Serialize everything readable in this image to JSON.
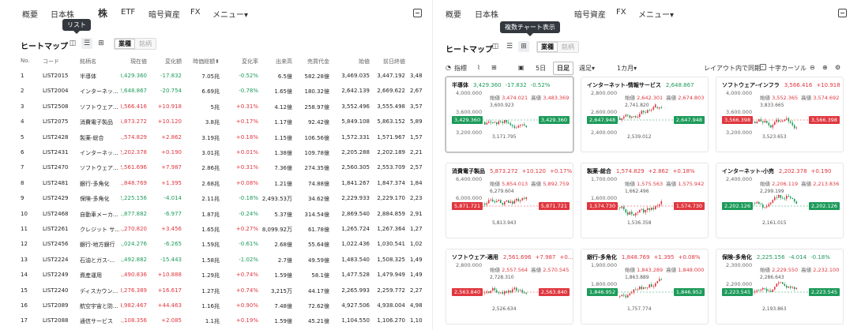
{
  "nav": {
    "items": [
      "概要",
      "日本株",
      "ETF",
      "暗号資産",
      "FX",
      "メニュー▾"
    ],
    "left_active": "株"
  },
  "toolbar": {
    "title": "ヒートマップ",
    "seg_active": "業種",
    "seg_other": "銘柄"
  },
  "tooltips": {
    "list": "リスト",
    "chart": "複数チャート表示"
  },
  "table": {
    "headers": [
      "No.",
      "コード",
      "銘柄名",
      "現在値",
      "変化額",
      "時価総額⬍",
      "変化率",
      "出来高",
      "売買代金",
      "始値",
      "前日終値"
    ],
    "rows": [
      [
        "1",
        "LIST2015",
        "半導体",
        "3,429.360",
        "-17.832",
        "7.05兆",
        "-0.52%",
        "6.5億",
        "582.28億",
        "3,469.035",
        "3,447.192",
        "3,48"
      ],
      [
        "2",
        "LIST2004",
        "インターネッ...",
        "2,648.867",
        "-20.754",
        "6.69兆",
        "-0.78%",
        "1.65億",
        "180.32億",
        "2,642.139",
        "2,669.622",
        "2,67"
      ],
      [
        "3",
        "LIST2508",
        "ソフトウェア...",
        "3,566.416",
        "+10.918",
        "5兆",
        "+0.31%",
        "4.12億",
        "258.97億",
        "3,552.496",
        "3,555.498",
        "3,57"
      ],
      [
        "4",
        "LIST2075",
        "消費電子製品",
        "5,873.272",
        "+10.120",
        "3.8兆",
        "+0.17%",
        "1.17億",
        "92.42億",
        "5,849.108",
        "5,863.152",
        "5,89"
      ],
      [
        "5",
        "LIST2428",
        "製薬-総合",
        "1,574.829",
        "+2.862",
        "3.19兆",
        "+0.18%",
        "1.15億",
        "106.56億",
        "1,572.331",
        "1,571.967",
        "1,57"
      ],
      [
        "6",
        "LIST2431",
        "インターネッ...",
        "2,202.378",
        "+0.190",
        "3.01兆",
        "+0.01%",
        "1.38億",
        "109.78億",
        "2,205.288",
        "2,202.189",
        "2,21"
      ],
      [
        "7",
        "LIST2470",
        "ソフトウェア...",
        "2,561.696",
        "+7.987",
        "2.86兆",
        "+0.31%",
        "7.36億",
        "274.35億",
        "2,560.305",
        "2,553.709",
        "2,57"
      ],
      [
        "8",
        "LIST2481",
        "銀行-多角化",
        "1,848.769",
        "+1.395",
        "2.68兆",
        "+0.08%",
        "1.21億",
        "74.88億",
        "1,841.267",
        "1,847.374",
        "1,84"
      ],
      [
        "9",
        "LIST2429",
        "保険-多角化",
        "2,225.156",
        "-4.014",
        "2.11兆",
        "-0.18%",
        "2,493.53万",
        "34.62億",
        "2,229.933",
        "2,229.170",
        "2,23"
      ],
      [
        "10",
        "LIST2468",
        "自動車メーカ...",
        "1,877.882",
        "-6.977",
        "1.87兆",
        "-0.24%",
        "5.37億",
        "314.54億",
        "2,869.540",
        "2,884.859",
        "2,91"
      ],
      [
        "11",
        "LIST2261",
        "クレジット サ...",
        "1,270.820",
        "+3.456",
        "1.65兆",
        "+0.27%",
        "8,099.92万",
        "61.78億",
        "1,265.724",
        "1,267.364",
        "1,27"
      ],
      [
        "12",
        "LIST2456",
        "銀行-地方銀行",
        "1,024.276",
        "-6.265",
        "1.59兆",
        "-0.61%",
        "2.68億",
        "55.64億",
        "1,022.436",
        "1,030.541",
        "1,02"
      ],
      [
        "13",
        "LIST2224",
        "石油とガス-...",
        "1,492.882",
        "-15.443",
        "1.58兆",
        "-1.02%",
        "2.7億",
        "49.59億",
        "1,483.540",
        "1,508.325",
        "1,49"
      ],
      [
        "14",
        "LIST2249",
        "資産運用",
        "1,490.836",
        "+10.888",
        "1.29兆",
        "+0.74%",
        "1.59億",
        "58.1億",
        "1,477.528",
        "1,479.949",
        "1,49"
      ],
      [
        "15",
        "LIST2240",
        "ディスカウン...",
        "3,276.389",
        "+16.617",
        "1.27兆",
        "+0.74%",
        "3,215万",
        "44.17億",
        "2,265.993",
        "2,259.772",
        "2,27"
      ],
      [
        "16",
        "LIST2089",
        "航空宇宙と防...",
        "4,982.467",
        "+44.463",
        "1.16兆",
        "+0.90%",
        "7.48億",
        "72.62億",
        "4,927.506",
        "4,938.004",
        "4,98"
      ],
      [
        "17",
        "LIST2088",
        "通信サービス",
        "1,108.356",
        "+2.085",
        "1.1兆",
        "+0.19%",
        "1.59億",
        "45.21億",
        "1,104.550",
        "1,106.270",
        "1,10"
      ]
    ]
  },
  "controls": {
    "indicator": "指標",
    "d5": "5日",
    "daily": "日足",
    "weekly": "週足▾",
    "month": "1カ月▾",
    "sync": "レイアウト内で同期：",
    "crosshair": "十字カーソル"
  },
  "cards": [
    {
      "title": "半導体",
      "price": "3,429.360",
      "chg": "-17.832",
      "pct": "-0.52%",
      "dir": "dn",
      "y1": "4,000.000",
      "y2": "3,600.000",
      "y3": "3,200.000",
      "open": "3,474.021",
      "high": "3,483.369",
      "hiv": "3,600.923",
      "lov": "3,171.795",
      "tagL": "3,429.360",
      "tagR": "3,429.360",
      "t": "g"
    },
    {
      "title": "インターネット-情報サービス",
      "price": "2,648.867",
      "chg": "",
      "pct": "",
      "dir": "dn",
      "y1": "2,800.000",
      "y2": "2,600.000",
      "y3": "2,400.000",
      "open": "2,642.301",
      "high": "2,674.803",
      "hiv": "2,741.820",
      "lov": "2,539.012",
      "tagL": "2,647.948",
      "tagR": "2,647.948",
      "t": "g"
    },
    {
      "title": "ソフトウェア-インフラ",
      "price": "3,566.416",
      "chg": "+10.918",
      "pct": "",
      "dir": "up",
      "y1": "4,000.000",
      "y2": "3,600.000",
      "y3": "3,200.000",
      "open": "3,552.365",
      "high": "3,574.692",
      "hiv": "3,833.665",
      "lov": "3,523.653",
      "tagL": "3,566.398",
      "tagR": "3,566.398",
      "t": "r"
    },
    {
      "title": "消費電子製品",
      "price": "5,873.272",
      "chg": "+10.120",
      "pct": "+0.17%",
      "dir": "up",
      "y1": "6,400.000",
      "y2": "6,000.000",
      "y3": "",
      "open": "5,854.013",
      "high": "5,892.759",
      "hiv": "6,279.604",
      "lov": "5,813.943",
      "tagL": "5,871.721",
      "tagR": "5,871.721",
      "t": "r"
    },
    {
      "title": "製薬-総合",
      "price": "1,574.829",
      "chg": "+2.862",
      "pct": "+0.18%",
      "dir": "up",
      "y1": "1,700.000",
      "y2": "1,600.000",
      "y3": "",
      "open": "1,575.563",
      "high": "1,575.942",
      "hiv": "1,662.496",
      "lov": "1,536.358",
      "tagL": "1,574.730",
      "tagR": "1,574.730",
      "t": "r"
    },
    {
      "title": "インターネット-小売",
      "price": "2,202.378",
      "chg": "+0.190",
      "pct": "",
      "dir": "up",
      "y1": "2,400.000",
      "y2": "",
      "y3": "",
      "open": "2,206.119",
      "high": "2,213.836",
      "hiv": "2,299.199",
      "lov": "2,161.015",
      "tagL": "2,202.126",
      "tagR": "2,202.126",
      "t": "g"
    },
    {
      "title": "ソフトウェア-適用",
      "price": "2,561.696",
      "chg": "+7.987",
      "pct": "+0...",
      "dir": "up",
      "y1": "2,800.000",
      "y2": "",
      "y3": "",
      "open": "2,557.564",
      "high": "2,570.545",
      "hiv": "2,728.310",
      "lov": "2,526.634",
      "tagL": "2,563.840",
      "tagR": "2,563.840",
      "t": "r"
    },
    {
      "title": "銀行-多角化",
      "price": "1,848.769",
      "chg": "+1.395",
      "pct": "+0.08%",
      "dir": "up",
      "y1": "1,900.000",
      "y2": "1,800.000",
      "y3": "",
      "open": "1,843.289",
      "high": "1,848.000",
      "hiv": "1,863.889",
      "lov": "1,757.774",
      "tagL": "1,846.952",
      "tagR": "1,846.952",
      "t": "g"
    },
    {
      "title": "保険-多角化",
      "price": "2,225.156",
      "chg": "-4.014",
      "pct": "-0.18%",
      "dir": "dn",
      "y1": "2,300.000",
      "y2": "2,200.000",
      "y3": "",
      "open": "2,229.550",
      "high": "2,232.100",
      "hiv": "2,286.643",
      "lov": "2,193.863",
      "tagL": "2,223.545",
      "tagR": "2,223.545",
      "t": "g"
    }
  ],
  "labels": {
    "open": "始値",
    "high": "高値"
  }
}
